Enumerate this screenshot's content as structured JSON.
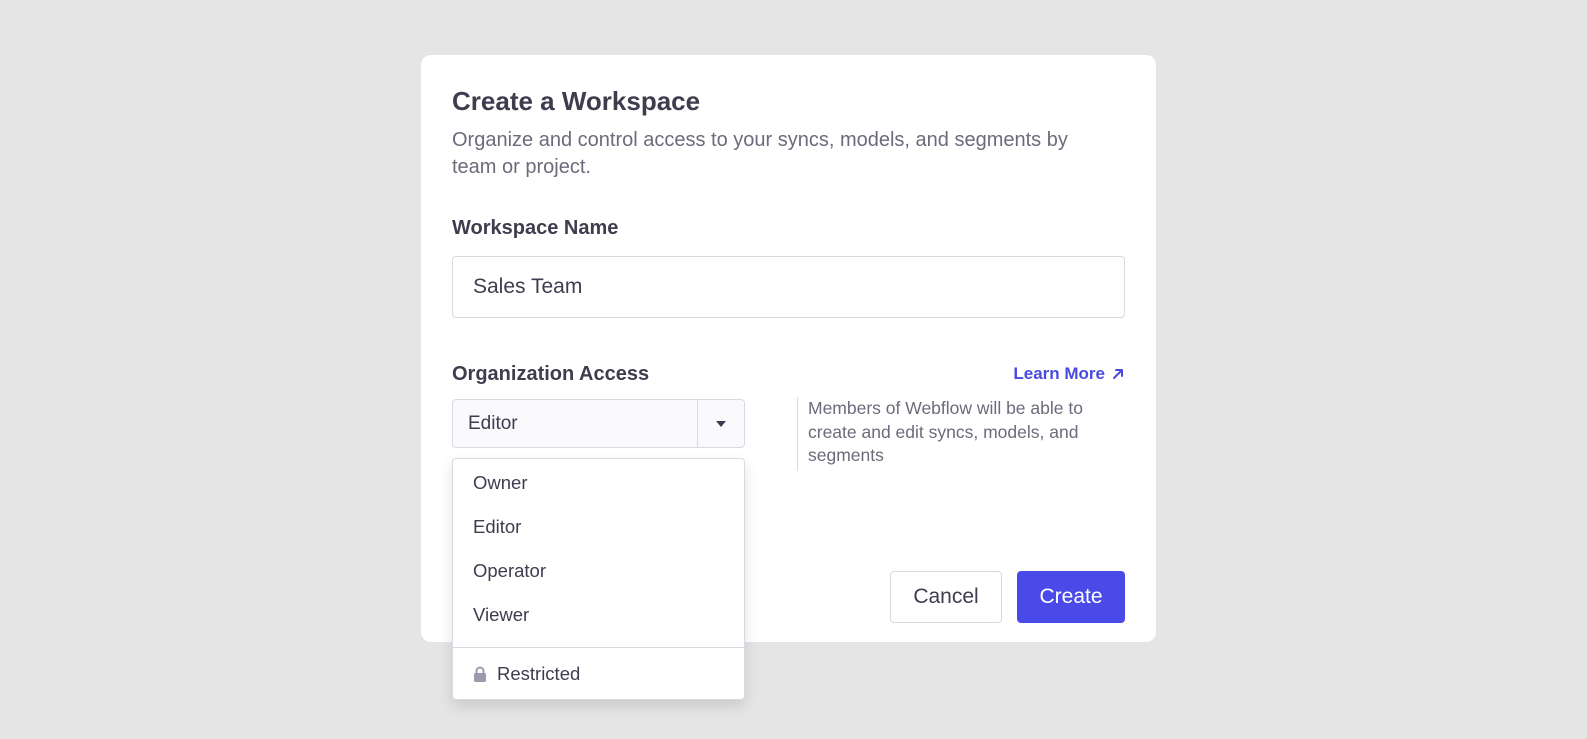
{
  "modal": {
    "title": "Create a Workspace",
    "subtitle": "Organize and control access to your syncs, models, and segments by team or project."
  },
  "workspace_name": {
    "label": "Workspace Name",
    "value": "Sales Team"
  },
  "org_access": {
    "label": "Organization Access",
    "learn_more": "Learn More",
    "learn_more_icon": "arrow-up-right-icon",
    "selected": "Editor",
    "help_text": "Members of Webflow will be able to create and edit syncs, models, and segments",
    "options": [
      "Owner",
      "Editor",
      "Operator",
      "Viewer"
    ],
    "restricted_label": "Restricted",
    "restricted_icon": "lock-icon"
  },
  "actions": {
    "cancel": "Cancel",
    "create": "Create"
  },
  "colors": {
    "accent": "#4a4ae8",
    "link": "#4a4ae0",
    "background": "#e5e5e6"
  }
}
